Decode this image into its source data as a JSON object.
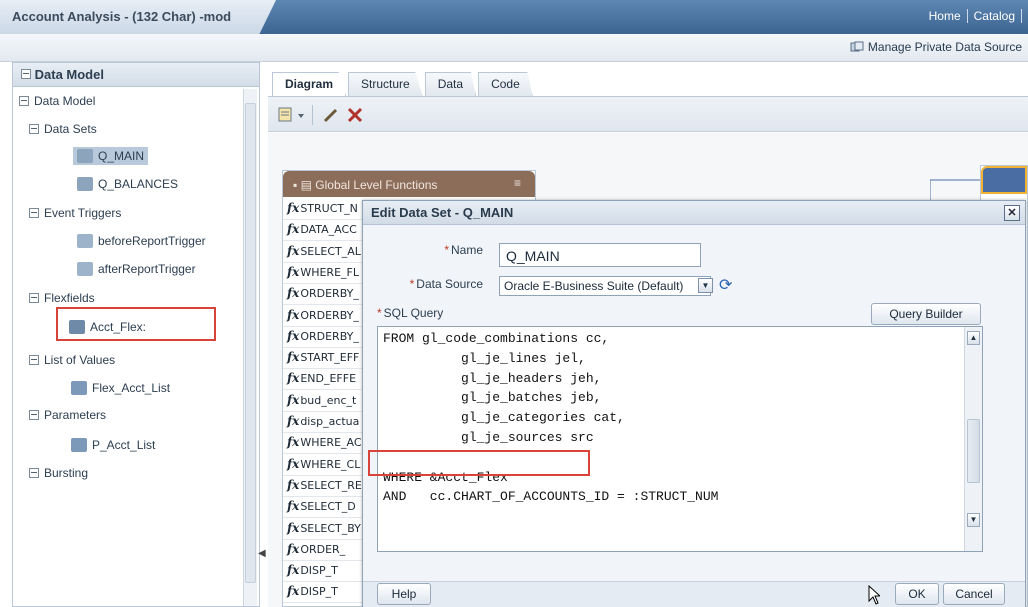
{
  "header": {
    "title": "Account Analysis - (132 Char) -mod",
    "nav": [
      "Home",
      "Catalog"
    ],
    "manage_link": "Manage Private Data Source"
  },
  "left_panel": {
    "heading": "Data Model",
    "tree": {
      "root": "Data Model",
      "data_sets_label": "Data Sets",
      "data_sets": [
        "Q_MAIN",
        "Q_BALANCES"
      ],
      "event_triggers_label": "Event Triggers",
      "event_triggers": [
        "beforeReportTrigger",
        "afterReportTrigger"
      ],
      "flexfields_label": "Flexfields",
      "flexfields": [
        "Acct_Flex:"
      ],
      "lov_label": "List of Values",
      "lovs": [
        "Flex_Acct_List"
      ],
      "parameters_label": "Parameters",
      "parameters": [
        "P_Acct_List"
      ],
      "bursting_label": "Bursting"
    }
  },
  "tabs": [
    "Diagram",
    "Structure",
    "Data",
    "Code"
  ],
  "active_tab": "Diagram",
  "functions_panel": {
    "title": "Global Level Functions",
    "items": [
      "STRUCT_N",
      "DATA_ACC",
      "SELECT_AL",
      "WHERE_FL",
      "ORDERBY_",
      "ORDERBY_",
      "ORDERBY_",
      "START_EFF",
      "END_EFFE",
      "bud_enc_t",
      "disp_actua",
      "WHERE_AC",
      "WHERE_CL",
      "SELECT_RE",
      "SELECT_D",
      "SELECT_BY",
      "ORDER_",
      "DISP_T",
      "DISP_T"
    ]
  },
  "dialog": {
    "title": "Edit Data Set - Q_MAIN",
    "close_label": "✕",
    "name_label": "Name",
    "name_value": "Q_MAIN",
    "source_label": "Data Source",
    "source_value": "Oracle E-Business Suite (Default)",
    "sql_label": "SQL Query",
    "query_builder_label": "Query Builder",
    "sql_lines": [
      "FROM gl_code_combinations cc,",
      "          gl_je_lines jel,",
      "          gl_je_headers jeh,",
      "          gl_je_batches jeb,",
      "          gl_je_categories cat,",
      "          gl_je_sources src",
      "",
      "WHERE &Acct_Flex",
      "AND   cc.CHART_OF_ACCOUNTS_ID = :STRUCT_NUM"
    ],
    "help_label": "Help",
    "ok_label": "OK",
    "cancel_label": "Cancel"
  }
}
